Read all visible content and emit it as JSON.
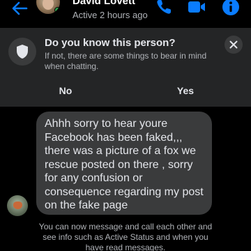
{
  "header": {
    "contact_name": "David Lovett",
    "active_status": "Active 2 hours ago",
    "accent_color": "#0a7cff",
    "icons": [
      "back-arrow-icon",
      "phone-icon",
      "video-camera-icon",
      "info-icon"
    ]
  },
  "prompt_card": {
    "title": "Do you know this person?",
    "text": "If not, there are some things to bear in mind when chatting.",
    "no_label": "No",
    "yes_label": "Yes",
    "icons": [
      "shield-icon",
      "close-icon"
    ]
  },
  "messages": [
    {
      "text": "Ahhh sorry to hear youre Facebook has been faked,,, there was a picture of a fox we rescue posted on there , sorry for any confusion or consequence regarding my post on the fake page"
    }
  ],
  "footer": {
    "text": "You can now message and call each other and see info such as Active Status and when you have read messages."
  }
}
